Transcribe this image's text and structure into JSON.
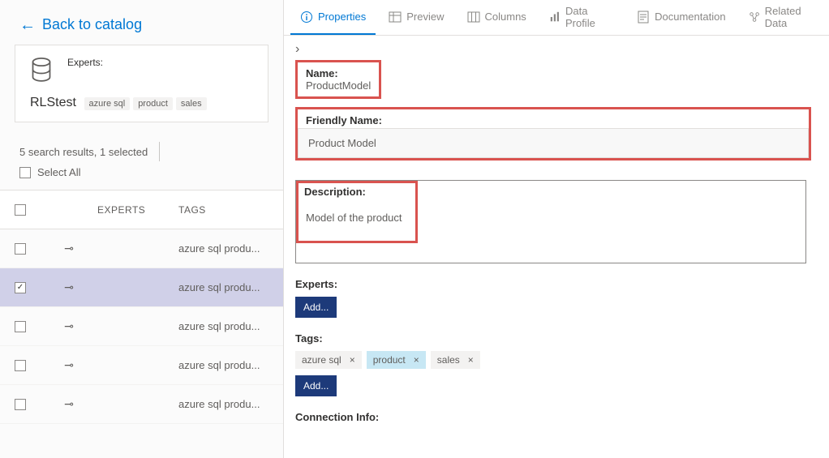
{
  "back_label": "Back to catalog",
  "card": {
    "experts_label": "Experts:",
    "name": "RLStest",
    "tags": [
      "azure sql",
      "product",
      "sales"
    ]
  },
  "results_summary": "5 search results, 1 selected",
  "select_all_label": "Select All",
  "columns": {
    "experts": "EXPERTS",
    "tags": "TAGS"
  },
  "rows": [
    {
      "checked": false,
      "tags": "azure sql produ..."
    },
    {
      "checked": true,
      "tags": "azure sql produ..."
    },
    {
      "checked": false,
      "tags": "azure sql produ..."
    },
    {
      "checked": false,
      "tags": "azure sql produ..."
    },
    {
      "checked": false,
      "tags": "azure sql produ..."
    }
  ],
  "tabs": {
    "properties": "Properties",
    "preview": "Preview",
    "columns": "Columns",
    "data_profile": "Data Profile",
    "documentation": "Documentation",
    "related_data": "Related Data"
  },
  "props": {
    "name_label": "Name:",
    "name_value": "ProductModel",
    "friendly_label": "Friendly Name:",
    "friendly_value": "Product Model",
    "description_label": "Description:",
    "description_value": "Model of the product",
    "experts_label": "Experts:",
    "tags_label": "Tags:",
    "connection_label": "Connection Info:",
    "add_label": "Add...",
    "tags": [
      "azure sql",
      "product",
      "sales"
    ]
  }
}
